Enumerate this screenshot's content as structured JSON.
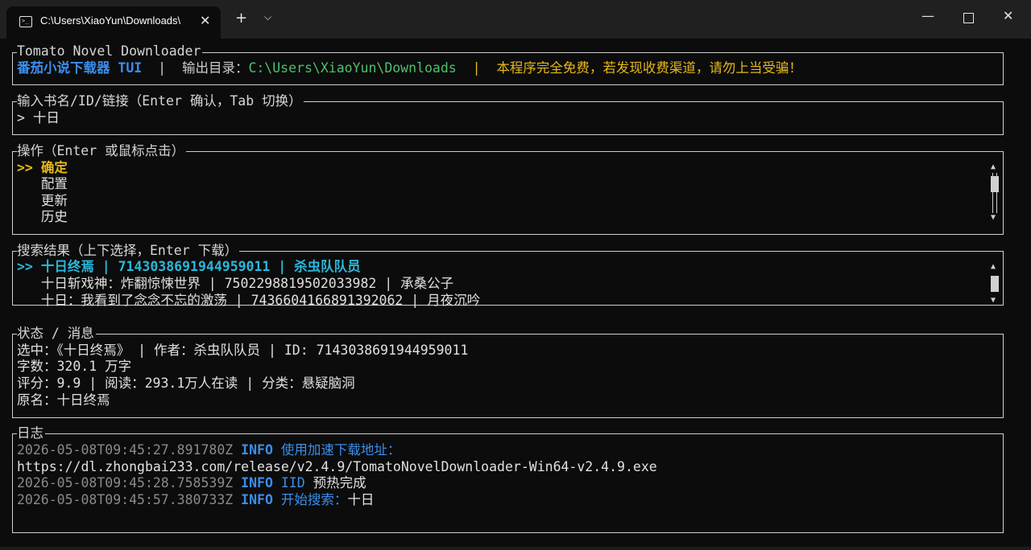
{
  "window": {
    "tab_title": "C:\\Users\\XiaoYun\\Downloads\\",
    "tab_close": "✕",
    "new_tab": "+",
    "tab_dropdown": "⌵",
    "minimize": "—",
    "close": "✕"
  },
  "header": {
    "title": "Tomato Novel Downloader",
    "app_name": "番茄小说下载器 TUI",
    "sep1": "|",
    "output_label": "输出目录：",
    "output_path": "C:\\Users\\XiaoYun\\Downloads",
    "sep2": "|",
    "notice": "本程序完全免费，若发现收费渠道，请勿上当受骗！"
  },
  "input": {
    "title": "输入书名/ID/链接（Enter 确认，Tab 切换）",
    "value": "> 十日"
  },
  "actions": {
    "title": "操作（Enter 或鼠标点击）",
    "items": [
      {
        "prefix": ">> ",
        "label": "确定"
      },
      {
        "prefix": "   ",
        "label": "配置"
      },
      {
        "prefix": "   ",
        "label": "更新"
      },
      {
        "prefix": "   ",
        "label": "历史"
      }
    ]
  },
  "results": {
    "title": "搜索结果（上下选择，Enter 下载）",
    "rows": [
      {
        "prefix": ">> ",
        "text": "十日终焉 | 7143038691944959011 | 杀虫队队员"
      },
      {
        "prefix": "   ",
        "text": "十日斩戏神：炸翻惊悚世界 | 7502298819502033982 | 承桑公子"
      },
      {
        "prefix": "   ",
        "text": "十日：我看到了念念不忘的激荡 | 7436604166891392062 | 月夜沉吟"
      }
    ]
  },
  "status": {
    "title": "状态 / 消息",
    "lines": [
      "选中：《十日终焉》 | 作者：杀虫队队员 | ID: 7143038691944959011",
      "字数：320.1 万字",
      "评分：9.9 | 阅读：293.1万人在读 | 分类：悬疑脑洞",
      "原名：十日终焉"
    ]
  },
  "log": {
    "title": "日志",
    "entries": [
      {
        "ts": "2026-05-08T09:45:27.891780Z",
        "level": "INFO",
        "msg": "使用加速下载地址：",
        "plain": ""
      },
      {
        "ts": "",
        "level": "",
        "msg": "",
        "plain": "https://dl.zhongbai233.com/release/v2.4.9/TomatoNovelDownloader-Win64-v2.4.9.exe"
      },
      {
        "ts": "2026-05-08T09:45:28.758539Z",
        "level": "INFO",
        "msg": "IID",
        "plain": "预热完成"
      },
      {
        "ts": "2026-05-08T09:45:57.380733Z",
        "level": "INFO",
        "msg": "开始搜索：",
        "plain": "十日"
      }
    ]
  },
  "colors": {
    "accent_blue": "#3b8eea",
    "path_green": "#4ec06a",
    "notice_yellow": "#e5b81b",
    "selected_yellow": "#e5b81b",
    "selected_cyan": "#29b8db",
    "timestamp_gray": "#8a8a8a"
  },
  "icons": {
    "terminal": "terminal-icon",
    "scroll_up": "▲",
    "scroll_down": "▼"
  }
}
